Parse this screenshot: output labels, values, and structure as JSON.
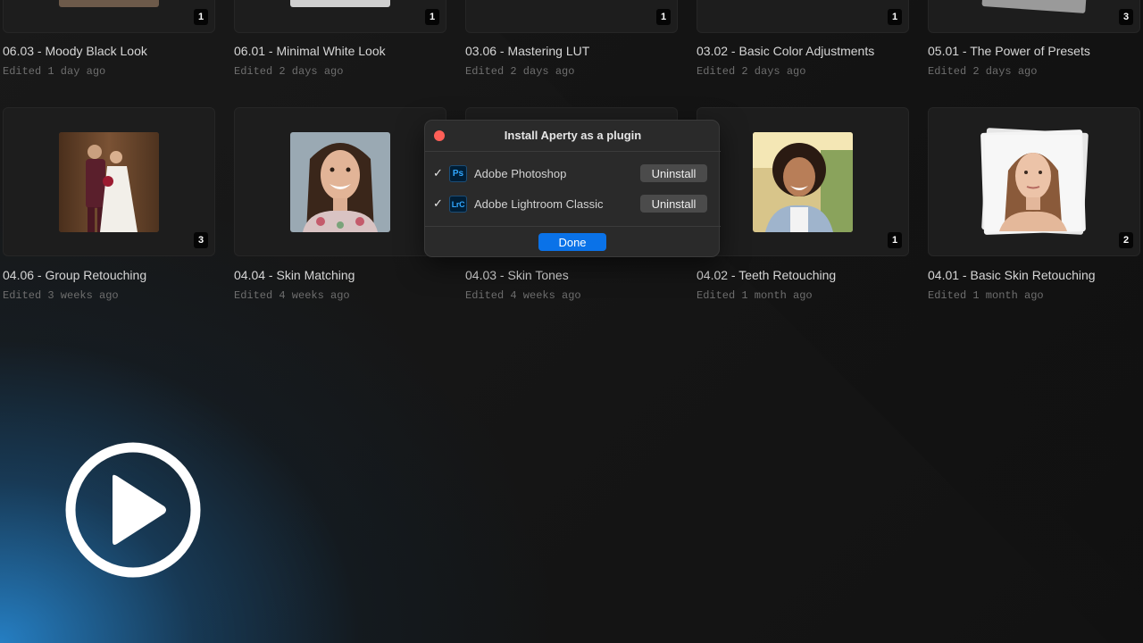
{
  "projects_row1": [
    {
      "title": "06.03 - Moody Black Look",
      "edited": "Edited 1 day ago",
      "count": "1"
    },
    {
      "title": "06.01 - Minimal White Look",
      "edited": "Edited 2 days ago",
      "count": "1"
    },
    {
      "title": "03.06 - Mastering LUT",
      "edited": "Edited 2 days ago",
      "count": "1"
    },
    {
      "title": "03.02 - Basic Color Adjustments",
      "edited": "Edited 2 days ago",
      "count": "1"
    },
    {
      "title": "05.01 - The Power of Presets",
      "edited": "Edited 2 days ago",
      "count": "3"
    }
  ],
  "projects_row2": [
    {
      "title": "04.06 - Group Retouching",
      "edited": "Edited 3 weeks ago",
      "count": "3"
    },
    {
      "title": "04.04 - Skin Matching",
      "edited": "Edited 4 weeks ago",
      "count": ""
    },
    {
      "title": "04.03 - Skin Tones",
      "edited": "Edited 4 weeks ago",
      "count": ""
    },
    {
      "title": "04.02 - Teeth Retouching",
      "edited": "Edited 1 month ago",
      "count": "1"
    },
    {
      "title": "04.01 - Basic Skin Retouching",
      "edited": "Edited 1 month ago",
      "count": "2"
    }
  ],
  "dialog": {
    "title": "Install Aperty as a plugin",
    "plugins": [
      {
        "icon_text": "Ps",
        "name": "Adobe Photoshop",
        "checked": "✓",
        "action": "Uninstall"
      },
      {
        "icon_text": "LrC",
        "name": "Adobe Lightroom Classic",
        "checked": "✓",
        "action": "Uninstall"
      }
    ],
    "done_label": "Done"
  },
  "colors": {
    "accent": "#0a72e8",
    "close": "#ff5f57",
    "glow": "#2684cc"
  },
  "icons": {
    "play": "play-circle-icon",
    "close": "close-dot-icon",
    "check": "checkmark-icon"
  }
}
